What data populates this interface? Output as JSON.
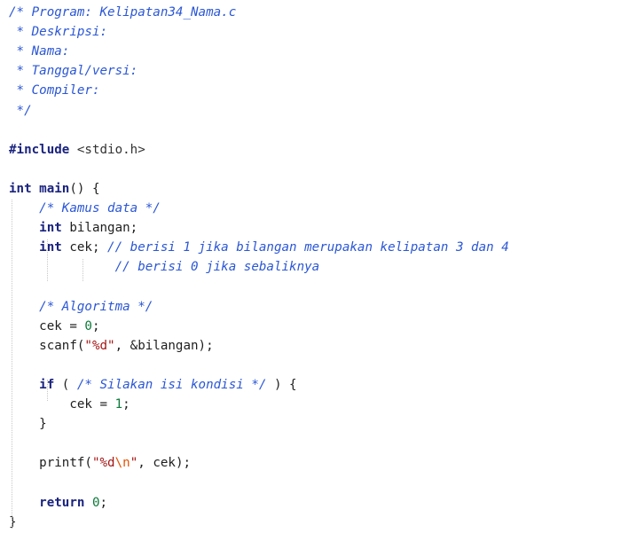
{
  "editor": {
    "lines": [
      [
        {
          "t": "/* Program: Kelipatan34_Nama.c",
          "c": "comment"
        }
      ],
      [
        {
          "t": " * Deskripsi:",
          "c": "comment"
        }
      ],
      [
        {
          "t": " * Nama:",
          "c": "comment"
        }
      ],
      [
        {
          "t": " * Tanggal/versi:",
          "c": "comment"
        }
      ],
      [
        {
          "t": " * Compiler:",
          "c": "comment"
        }
      ],
      [
        {
          "t": " */",
          "c": "comment"
        }
      ],
      [],
      [
        {
          "t": "#include",
          "c": "preproc"
        },
        {
          "t": " <stdio.h>",
          "c": "header"
        }
      ],
      [],
      [
        {
          "t": "int",
          "c": "keyword"
        },
        {
          "t": " ",
          "c": "text"
        },
        {
          "t": "main",
          "c": "fn"
        },
        {
          "t": "() {",
          "c": "text"
        }
      ],
      [
        {
          "t": "    ",
          "c": "text"
        },
        {
          "t": "/* Kamus data */",
          "c": "comment"
        }
      ],
      [
        {
          "t": "    ",
          "c": "text"
        },
        {
          "t": "int",
          "c": "keyword"
        },
        {
          "t": " bilangan;",
          "c": "text"
        }
      ],
      [
        {
          "t": "    ",
          "c": "text"
        },
        {
          "t": "int",
          "c": "keyword"
        },
        {
          "t": " cek; ",
          "c": "text"
        },
        {
          "t": "// berisi 1 jika bilangan merupakan kelipatan 3 dan 4",
          "c": "comment"
        }
      ],
      [
        {
          "t": "              ",
          "c": "text"
        },
        {
          "t": "// berisi 0 jika sebaliknya",
          "c": "comment"
        }
      ],
      [],
      [
        {
          "t": "    ",
          "c": "text"
        },
        {
          "t": "/* Algoritma */",
          "c": "comment"
        }
      ],
      [
        {
          "t": "    cek = ",
          "c": "text"
        },
        {
          "t": "0",
          "c": "number"
        },
        {
          "t": ";",
          "c": "text"
        }
      ],
      [
        {
          "t": "    scanf(",
          "c": "text"
        },
        {
          "t": "\"%d\"",
          "c": "string"
        },
        {
          "t": ", &bilangan);",
          "c": "text"
        }
      ],
      [],
      [
        {
          "t": "    ",
          "c": "text"
        },
        {
          "t": "if",
          "c": "keyword"
        },
        {
          "t": " ( ",
          "c": "text"
        },
        {
          "t": "/* Silakan isi kondisi */",
          "c": "comment"
        },
        {
          "t": " ) {",
          "c": "text"
        }
      ],
      [
        {
          "t": "        cek = ",
          "c": "text"
        },
        {
          "t": "1",
          "c": "number"
        },
        {
          "t": ";",
          "c": "text"
        }
      ],
      [
        {
          "t": "    }",
          "c": "text"
        }
      ],
      [],
      [
        {
          "t": "    printf(",
          "c": "text"
        },
        {
          "t": "\"%d",
          "c": "string"
        },
        {
          "t": "\\n",
          "c": "esc"
        },
        {
          "t": "\"",
          "c": "string"
        },
        {
          "t": ", cek);",
          "c": "text"
        }
      ],
      [],
      [
        {
          "t": "    ",
          "c": "text"
        },
        {
          "t": "return",
          "c": "keyword"
        },
        {
          "t": " ",
          "c": "text"
        },
        {
          "t": "0",
          "c": "number"
        },
        {
          "t": ";",
          "c": "text"
        }
      ],
      [
        {
          "t": "}",
          "c": "text"
        }
      ]
    ]
  }
}
